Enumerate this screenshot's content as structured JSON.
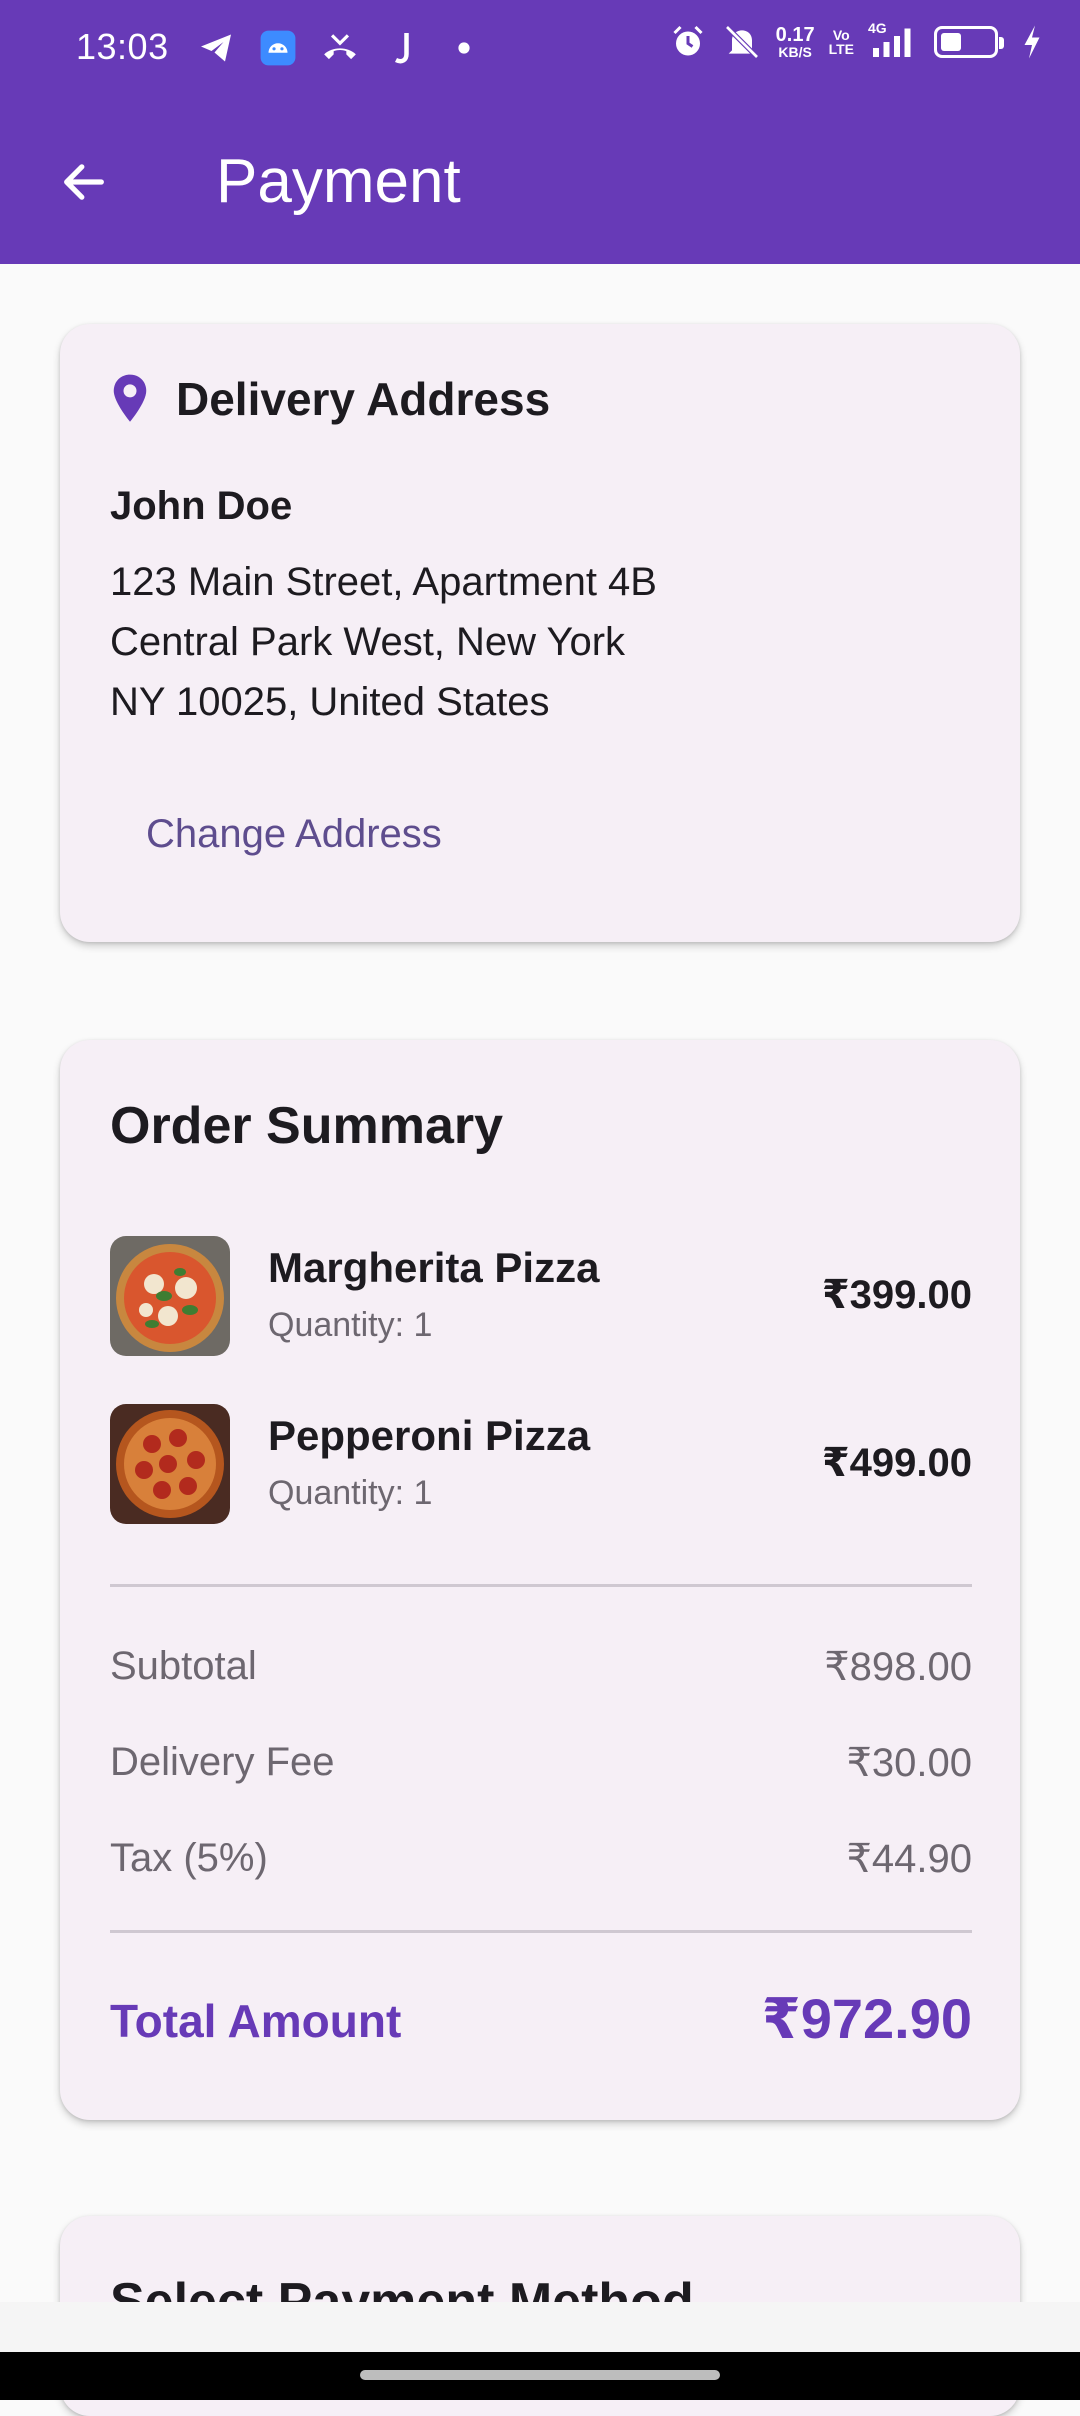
{
  "status_bar": {
    "time": "13:03",
    "net_speed_value": "0.17",
    "net_speed_unit": "KB/S",
    "volte_top": "Vo",
    "volte_bottom": "LTE",
    "network": "4G",
    "battery_level": 0.4,
    "icons": [
      "telegram-icon",
      "android-icon",
      "missed-call-icon",
      "j-app-icon",
      "dot-icon",
      "alarm-icon",
      "silent-icon",
      "signal-icon",
      "battery-icon",
      "charging-icon"
    ]
  },
  "app_bar": {
    "title": "Payment",
    "back_icon": "arrow-back-icon"
  },
  "address_card": {
    "title": "Delivery Address",
    "icon": "location-pin-icon",
    "name": "John Doe",
    "line1": "123 Main Street, Apartment 4B",
    "line2": "Central Park West, New York",
    "line3": "NY 10025, United States",
    "change_button": "Change Address"
  },
  "order_summary": {
    "title": "Order Summary",
    "items": [
      {
        "name": "Margherita Pizza",
        "quantity": "Quantity: 1",
        "price": "₹399.00"
      },
      {
        "name": "Pepperoni Pizza",
        "quantity": "Quantity: 1",
        "price": "₹499.00"
      }
    ],
    "subtotal_label": "Subtotal",
    "subtotal_value": "₹898.00",
    "delivery_label": "Delivery Fee",
    "delivery_value": "₹30.00",
    "tax_label": "Tax (5%)",
    "tax_value": "₹44.90",
    "total_label": "Total Amount",
    "total_value": "₹972.90"
  },
  "payment_card": {
    "title": "Select Payment Method"
  },
  "colors": {
    "primary": "#673AB7",
    "card_background": "#F6EFF6",
    "secondary_text": "#6D6770",
    "button_text": "#5E4D8E"
  }
}
